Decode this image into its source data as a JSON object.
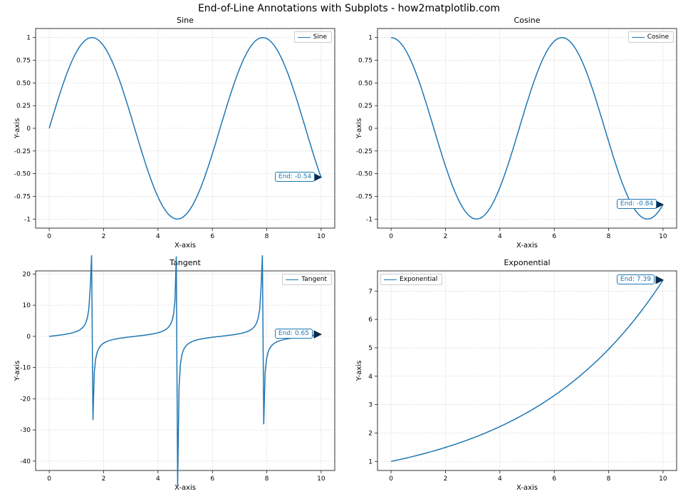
{
  "suptitle": "End-of-Line Annotations with Subplots - how2matplotlib.com",
  "xlabel": "X-axis",
  "ylabel": "Y-axis",
  "color": "#1f77b4",
  "subplots": {
    "tl": {
      "title": "Sine",
      "legend": "Sine",
      "annot": "End: -0.54",
      "legend_pos": "tr"
    },
    "tr": {
      "title": "Cosine",
      "legend": "Cosine",
      "annot": "End: -0.84",
      "legend_pos": "tr"
    },
    "bl": {
      "title": "Tangent",
      "legend": "Tangent",
      "annot": "End: 0.65",
      "legend_pos": "tr"
    },
    "br": {
      "title": "Exponential",
      "legend": "Exponential",
      "annot": "End: 7.39",
      "legend_pos": "tl"
    }
  },
  "chart_data": [
    {
      "id": "tl",
      "type": "line",
      "title": "Sine",
      "xlabel": "X-axis",
      "ylabel": "Y-axis",
      "xlim": [
        -0.5,
        10.5
      ],
      "ylim": [
        -1.1,
        1.1
      ],
      "xticks": [
        0,
        2,
        4,
        6,
        8,
        10
      ],
      "yticks": [
        -1.0,
        -0.75,
        -0.5,
        -0.25,
        0.0,
        0.25,
        0.5,
        0.75,
        1.0
      ],
      "series": [
        {
          "name": "Sine",
          "fn": "sin",
          "end_value": -0.54
        }
      ],
      "annotation": "End: -0.54",
      "legend_pos": "upper right",
      "grid": true
    },
    {
      "id": "tr",
      "type": "line",
      "title": "Cosine",
      "xlabel": "X-axis",
      "ylabel": "Y-axis",
      "xlim": [
        -0.5,
        10.5
      ],
      "ylim": [
        -1.1,
        1.1
      ],
      "xticks": [
        0,
        2,
        4,
        6,
        8,
        10
      ],
      "yticks": [
        -1.0,
        -0.75,
        -0.5,
        -0.25,
        0.0,
        0.25,
        0.5,
        0.75,
        1.0
      ],
      "series": [
        {
          "name": "Cosine",
          "fn": "cos",
          "end_value": -0.84
        }
      ],
      "annotation": "End: -0.84",
      "legend_pos": "upper right",
      "grid": true
    },
    {
      "id": "bl",
      "type": "line",
      "title": "Tangent",
      "xlabel": "X-axis",
      "ylabel": "Y-axis",
      "xlim": [
        -0.5,
        10.5
      ],
      "ylim": [
        -43,
        21
      ],
      "xticks": [
        0,
        2,
        4,
        6,
        8,
        10
      ],
      "yticks": [
        -40,
        -30,
        -20,
        -10,
        0,
        10,
        20
      ],
      "series": [
        {
          "name": "Tangent",
          "fn": "tan",
          "end_value": 0.65
        }
      ],
      "annotation": "End: 0.65",
      "legend_pos": "upper right",
      "grid": true
    },
    {
      "id": "br",
      "type": "line",
      "title": "Exponential",
      "xlabel": "X-axis",
      "ylabel": "Y-axis",
      "xlim": [
        -0.5,
        10.5
      ],
      "ylim": [
        0.68,
        7.71
      ],
      "xticks": [
        0,
        2,
        4,
        6,
        8,
        10
      ],
      "yticks": [
        1,
        2,
        3,
        4,
        5,
        6,
        7
      ],
      "series": [
        {
          "name": "Exponential",
          "fn": "exp5",
          "end_value": 7.39
        }
      ],
      "annotation": "End: 7.39",
      "legend_pos": "upper left",
      "grid": true
    }
  ]
}
